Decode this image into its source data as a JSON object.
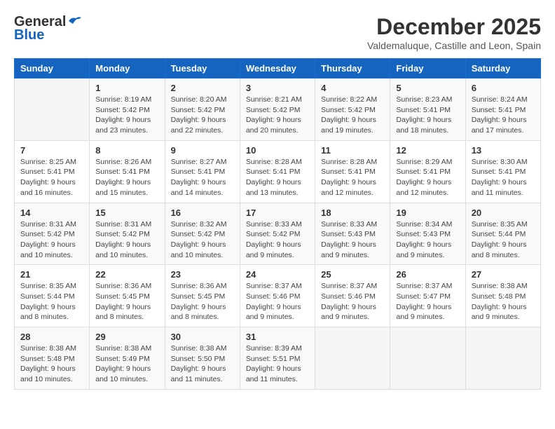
{
  "header": {
    "logo_general": "General",
    "logo_blue": "Blue",
    "month_title": "December 2025",
    "location": "Valdemaluque, Castille and Leon, Spain"
  },
  "days_of_week": [
    "Sunday",
    "Monday",
    "Tuesday",
    "Wednesday",
    "Thursday",
    "Friday",
    "Saturday"
  ],
  "weeks": [
    [
      {
        "day": "",
        "info": ""
      },
      {
        "day": "1",
        "info": "Sunrise: 8:19 AM\nSunset: 5:42 PM\nDaylight: 9 hours\nand 23 minutes."
      },
      {
        "day": "2",
        "info": "Sunrise: 8:20 AM\nSunset: 5:42 PM\nDaylight: 9 hours\nand 22 minutes."
      },
      {
        "day": "3",
        "info": "Sunrise: 8:21 AM\nSunset: 5:42 PM\nDaylight: 9 hours\nand 20 minutes."
      },
      {
        "day": "4",
        "info": "Sunrise: 8:22 AM\nSunset: 5:42 PM\nDaylight: 9 hours\nand 19 minutes."
      },
      {
        "day": "5",
        "info": "Sunrise: 8:23 AM\nSunset: 5:41 PM\nDaylight: 9 hours\nand 18 minutes."
      },
      {
        "day": "6",
        "info": "Sunrise: 8:24 AM\nSunset: 5:41 PM\nDaylight: 9 hours\nand 17 minutes."
      }
    ],
    [
      {
        "day": "7",
        "info": "Sunrise: 8:25 AM\nSunset: 5:41 PM\nDaylight: 9 hours\nand 16 minutes."
      },
      {
        "day": "8",
        "info": "Sunrise: 8:26 AM\nSunset: 5:41 PM\nDaylight: 9 hours\nand 15 minutes."
      },
      {
        "day": "9",
        "info": "Sunrise: 8:27 AM\nSunset: 5:41 PM\nDaylight: 9 hours\nand 14 minutes."
      },
      {
        "day": "10",
        "info": "Sunrise: 8:28 AM\nSunset: 5:41 PM\nDaylight: 9 hours\nand 13 minutes."
      },
      {
        "day": "11",
        "info": "Sunrise: 8:28 AM\nSunset: 5:41 PM\nDaylight: 9 hours\nand 12 minutes."
      },
      {
        "day": "12",
        "info": "Sunrise: 8:29 AM\nSunset: 5:41 PM\nDaylight: 9 hours\nand 12 minutes."
      },
      {
        "day": "13",
        "info": "Sunrise: 8:30 AM\nSunset: 5:41 PM\nDaylight: 9 hours\nand 11 minutes."
      }
    ],
    [
      {
        "day": "14",
        "info": "Sunrise: 8:31 AM\nSunset: 5:42 PM\nDaylight: 9 hours\nand 10 minutes."
      },
      {
        "day": "15",
        "info": "Sunrise: 8:31 AM\nSunset: 5:42 PM\nDaylight: 9 hours\nand 10 minutes."
      },
      {
        "day": "16",
        "info": "Sunrise: 8:32 AM\nSunset: 5:42 PM\nDaylight: 9 hours\nand 10 minutes."
      },
      {
        "day": "17",
        "info": "Sunrise: 8:33 AM\nSunset: 5:42 PM\nDaylight: 9 hours\nand 9 minutes."
      },
      {
        "day": "18",
        "info": "Sunrise: 8:33 AM\nSunset: 5:43 PM\nDaylight: 9 hours\nand 9 minutes."
      },
      {
        "day": "19",
        "info": "Sunrise: 8:34 AM\nSunset: 5:43 PM\nDaylight: 9 hours\nand 9 minutes."
      },
      {
        "day": "20",
        "info": "Sunrise: 8:35 AM\nSunset: 5:44 PM\nDaylight: 9 hours\nand 8 minutes."
      }
    ],
    [
      {
        "day": "21",
        "info": "Sunrise: 8:35 AM\nSunset: 5:44 PM\nDaylight: 9 hours\nand 8 minutes."
      },
      {
        "day": "22",
        "info": "Sunrise: 8:36 AM\nSunset: 5:45 PM\nDaylight: 9 hours\nand 8 minutes."
      },
      {
        "day": "23",
        "info": "Sunrise: 8:36 AM\nSunset: 5:45 PM\nDaylight: 9 hours\nand 8 minutes."
      },
      {
        "day": "24",
        "info": "Sunrise: 8:37 AM\nSunset: 5:46 PM\nDaylight: 9 hours\nand 9 minutes."
      },
      {
        "day": "25",
        "info": "Sunrise: 8:37 AM\nSunset: 5:46 PM\nDaylight: 9 hours\nand 9 minutes."
      },
      {
        "day": "26",
        "info": "Sunrise: 8:37 AM\nSunset: 5:47 PM\nDaylight: 9 hours\nand 9 minutes."
      },
      {
        "day": "27",
        "info": "Sunrise: 8:38 AM\nSunset: 5:48 PM\nDaylight: 9 hours\nand 9 minutes."
      }
    ],
    [
      {
        "day": "28",
        "info": "Sunrise: 8:38 AM\nSunset: 5:48 PM\nDaylight: 9 hours\nand 10 minutes."
      },
      {
        "day": "29",
        "info": "Sunrise: 8:38 AM\nSunset: 5:49 PM\nDaylight: 9 hours\nand 10 minutes."
      },
      {
        "day": "30",
        "info": "Sunrise: 8:38 AM\nSunset: 5:50 PM\nDaylight: 9 hours\nand 11 minutes."
      },
      {
        "day": "31",
        "info": "Sunrise: 8:39 AM\nSunset: 5:51 PM\nDaylight: 9 hours\nand 11 minutes."
      },
      {
        "day": "",
        "info": ""
      },
      {
        "day": "",
        "info": ""
      },
      {
        "day": "",
        "info": ""
      }
    ]
  ]
}
